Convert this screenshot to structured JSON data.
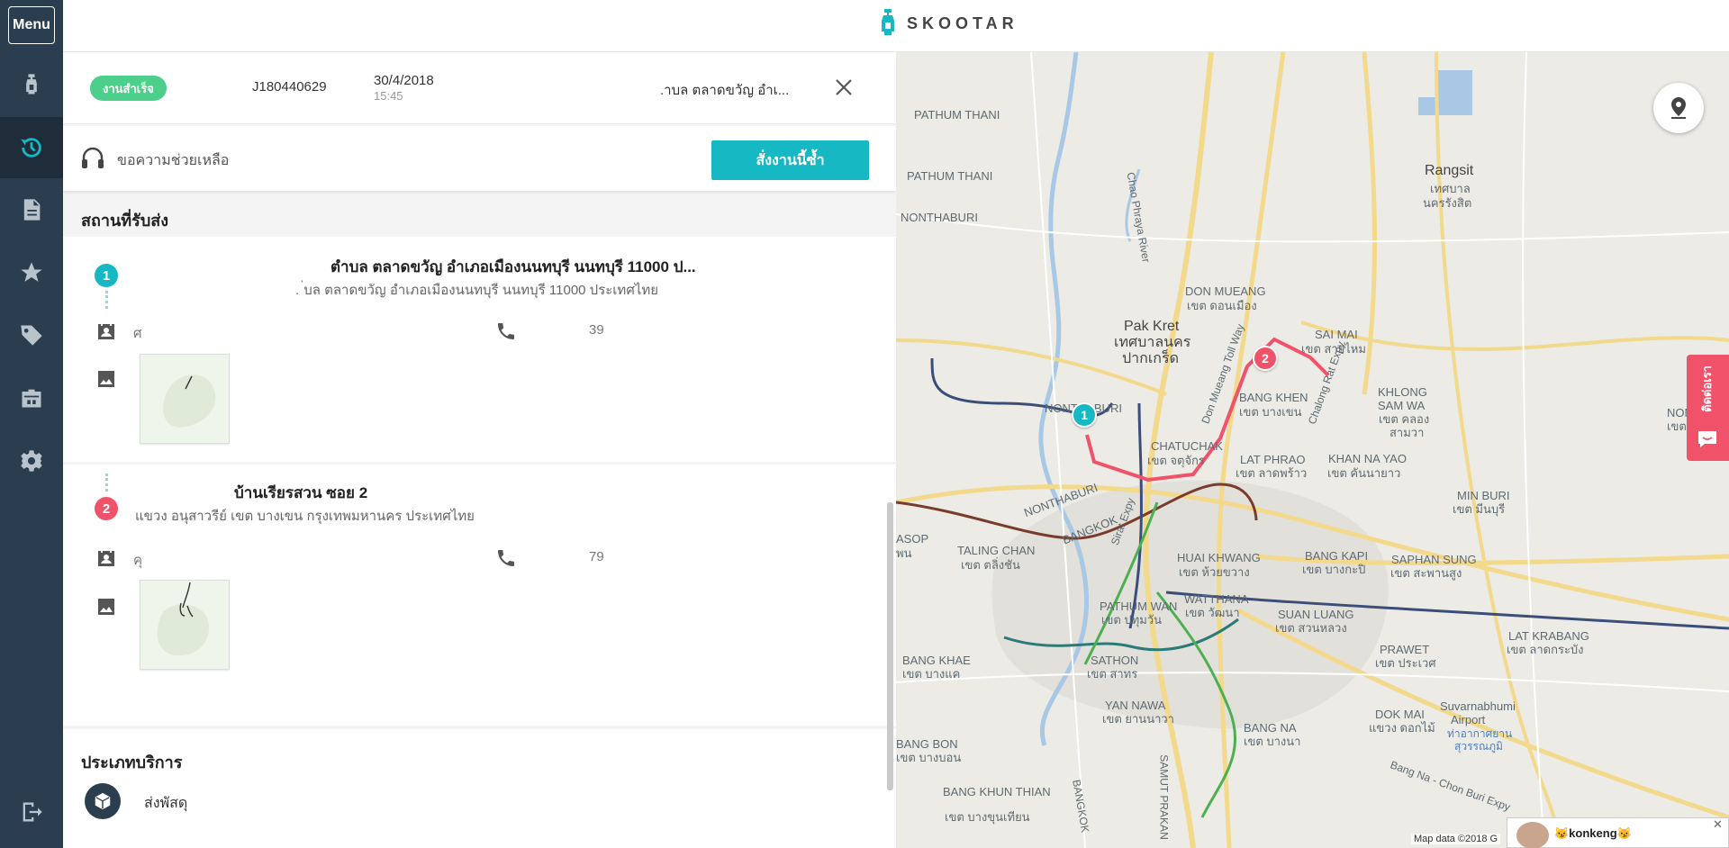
{
  "sidebar": {
    "menu_label": "Menu",
    "items": [
      {
        "icon": "scooter-icon"
      },
      {
        "icon": "history-icon",
        "active": true
      },
      {
        "icon": "document-icon"
      },
      {
        "icon": "star-icon"
      },
      {
        "icon": "tag-icon"
      },
      {
        "icon": "business-icon"
      },
      {
        "icon": "gear-icon"
      }
    ],
    "logout_icon": "logout-icon"
  },
  "header": {
    "brand": "SKOOTAR"
  },
  "job": {
    "status": "งานสำเร็จ",
    "id": "J180440629",
    "date": "30/4/2018",
    "time": "15:45",
    "address_short": ".าบล ตลาดขวัญ อำเ...",
    "status_color": "#4ccf8a"
  },
  "help": {
    "label": "ขอความช่วยเหลือ",
    "reorder_label": "สั่งงานนี้ซ้ำ"
  },
  "locations": {
    "section_title": "สถานที่รับส่ง",
    "items": [
      {
        "number": "1",
        "title": "ตำบล ตลาดขวัญ อำเภอเมืองนนทบุรี นนทบุรี 11000 ป...",
        "subtitle": ". ่บล ตลาดขวัญ อำเภอเมืองนนทบุรี นนทบุรี 11000 ประเทศไทย",
        "contact_name": "ศ",
        "phone": "39"
      },
      {
        "number": "2",
        "title": "บ้านเรียรสวน ซอย 2",
        "subtitle": "แขวง อนุสาวรีย์ เขต บางเขน กรุงเทพมหานคร ประเทศไทย",
        "contact_name": "คุ",
        "phone": "79"
      }
    ]
  },
  "service": {
    "section_title": "ประเภทบริการ",
    "label": "ส่งพัสดุ"
  },
  "map": {
    "labels": {
      "pathum_thani": "PATHUM THANI",
      "rangsit": "Rangsit",
      "rangsit_th1": "เทศบาล",
      "rangsit_th2": "นครรังสิต",
      "pathum_thani2": "PATHUM THANI",
      "nonthaburi_top": "NONTHABURI",
      "don_mueang": "DON MUEANG",
      "don_mueang_th": "เขต ดอนเมือง",
      "pak_kret": "Pak Kret",
      "pak_kret_th1": "เทศบาลนคร",
      "pak_kret_th2": "ปากเกร็ด",
      "sai_mai": "SAI MAI",
      "sai_mai_th": "เขต สายไหม",
      "bang_khen": "BANG KHEN",
      "bang_khen_th": "เขต บางเขน",
      "khlong_sam_wa": "KHLONG",
      "khlong_sam_wa2": "SAM WA",
      "khlong_sam_wa_th": "เขต คลอง",
      "khlong_sam_wa_th2": "สามวา",
      "nong_chok": "NONG C",
      "nong_chok_th": "เขต หน",
      "nonthaburi_mid": "NONTHABURI",
      "chatuchak": "CHATUCHAK",
      "chatuchak_th": "เขต จตุจักร",
      "lat_phrao": "LAT PHRAO",
      "lat_phrao_th": "เขต ลาดพร้าว",
      "khan_na_yao": "KHAN NA YAO",
      "khan_na_yao_th": "เขต คันนายาว",
      "min_buri": "MIN BURI",
      "min_buri_th": "เขต มีนบุรี",
      "nonthaburi_low": "NONTHABURI",
      "bangkok_river": "BANGKOK",
      "taling_chan": "TALING CHAN",
      "taling_chan_th": "เขต ตลิ่งชัน",
      "asop": "ASOP",
      "asop_th": "พน",
      "huai_khwang": "HUAI KHWANG",
      "huai_khwang_th": "เขต ห้วยขวาง",
      "bang_kapi": "BANG KAPI",
      "bang_kapi_th": "เขต บางกะปิ",
      "saphan_sung": "SAPHAN SUNG",
      "saphan_sung_th": "เขต สะพานสูง",
      "pathum_wan": "PATHUM WAN",
      "pathum_wan_th": "เขต ปทุมวัน",
      "watthana": "WATTHANA",
      "watthana_th": "เขต วัฒนา",
      "suan_luang": "SUAN LUANG",
      "suan_luang_th": "เขต สวนหลวง",
      "lat_krabang": "LAT KRABANG",
      "lat_krabang_th": "เขต ลาดกระบัง",
      "bang_khae": "BANG KHAE",
      "bang_khae_th": "เขต บางแค",
      "sathon": "SATHON",
      "sathon_th": "เขต สาทร",
      "prawet": "PRAWET",
      "prawet_th": "เขต ประเวศ",
      "suvarnabhumi": "Suvarnabhumi",
      "suvarnabhumi2": "Airport",
      "suvarnabhumi_th": "ท่าอากาศยาน",
      "suvarnabhumi_th2": "สุวรรณภูมิ",
      "yan_nawa": "YAN NAWA",
      "yan_nawa_th": "เขต ยานนาวา",
      "dok_mai": "DOK MAI",
      "dok_mai_th": "แขวง ดอกไม้",
      "bang_bon": "BANG BON",
      "bang_bon_th": "เขต บางบอน",
      "bang_na": "BANG NA",
      "bang_na_th": "เขต บางนา",
      "bang_khun_thian": "BANG KHUN THIAN",
      "bang_khun_thian_th": "เขต บางขุนเทียน",
      "samut_prakan": "SAMUT PRAKAN",
      "bangkok_vert": "BANGKOK",
      "bang_na_road": "Bang Na - Chon Buri Expy",
      "chalong_rat": "Chalong Rat Expy",
      "sirat": "Sirat Expy",
      "toll_way": "Don Mueang Toll Way",
      "chao_phraya": "Chao Phraya River"
    },
    "map_data": "Map data ©2018 G",
    "pin1": "1",
    "pin2": "2",
    "route_color": "#f0526a"
  },
  "chat_tab": {
    "label": "ติดต่อเรา"
  },
  "chat_popup": {
    "name": "😼konkeng😼"
  }
}
